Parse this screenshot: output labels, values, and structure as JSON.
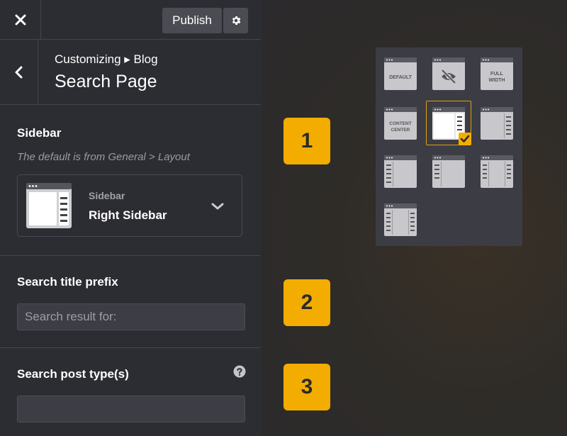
{
  "topbar": {
    "publish_label": "Publish"
  },
  "header": {
    "breadcrumb": "Customizing ▸ Blog",
    "title": "Search Page"
  },
  "sidebar_section": {
    "label": "Sidebar",
    "note": "The default is from General > Layout",
    "select": {
      "caption": "Sidebar",
      "value": "Right Sidebar"
    }
  },
  "search_title_prefix": {
    "label": "Search title prefix",
    "value": "",
    "placeholder": "Search result for:"
  },
  "search_post_types": {
    "label": "Search post type(s)",
    "value": ""
  },
  "badges": [
    "1",
    "2",
    "3"
  ],
  "layout_options": {
    "default_label": "DEFAULT",
    "full_width_label_1": "FULL",
    "full_width_label_2": "WIDTH",
    "content_center_label_1": "CONTENT",
    "content_center_label_2": "CENTER"
  },
  "colors": {
    "accent": "#f3ad00",
    "panel": "#2c2c33",
    "thumb": "#c8c8cc"
  },
  "icons": {
    "close": "close-icon",
    "gear": "gear-icon",
    "back": "chevron-left-icon",
    "chevron": "chevron-down-icon",
    "help": "question-circle-icon",
    "eye_slash": "eye-slash-icon",
    "check": "check-icon"
  }
}
